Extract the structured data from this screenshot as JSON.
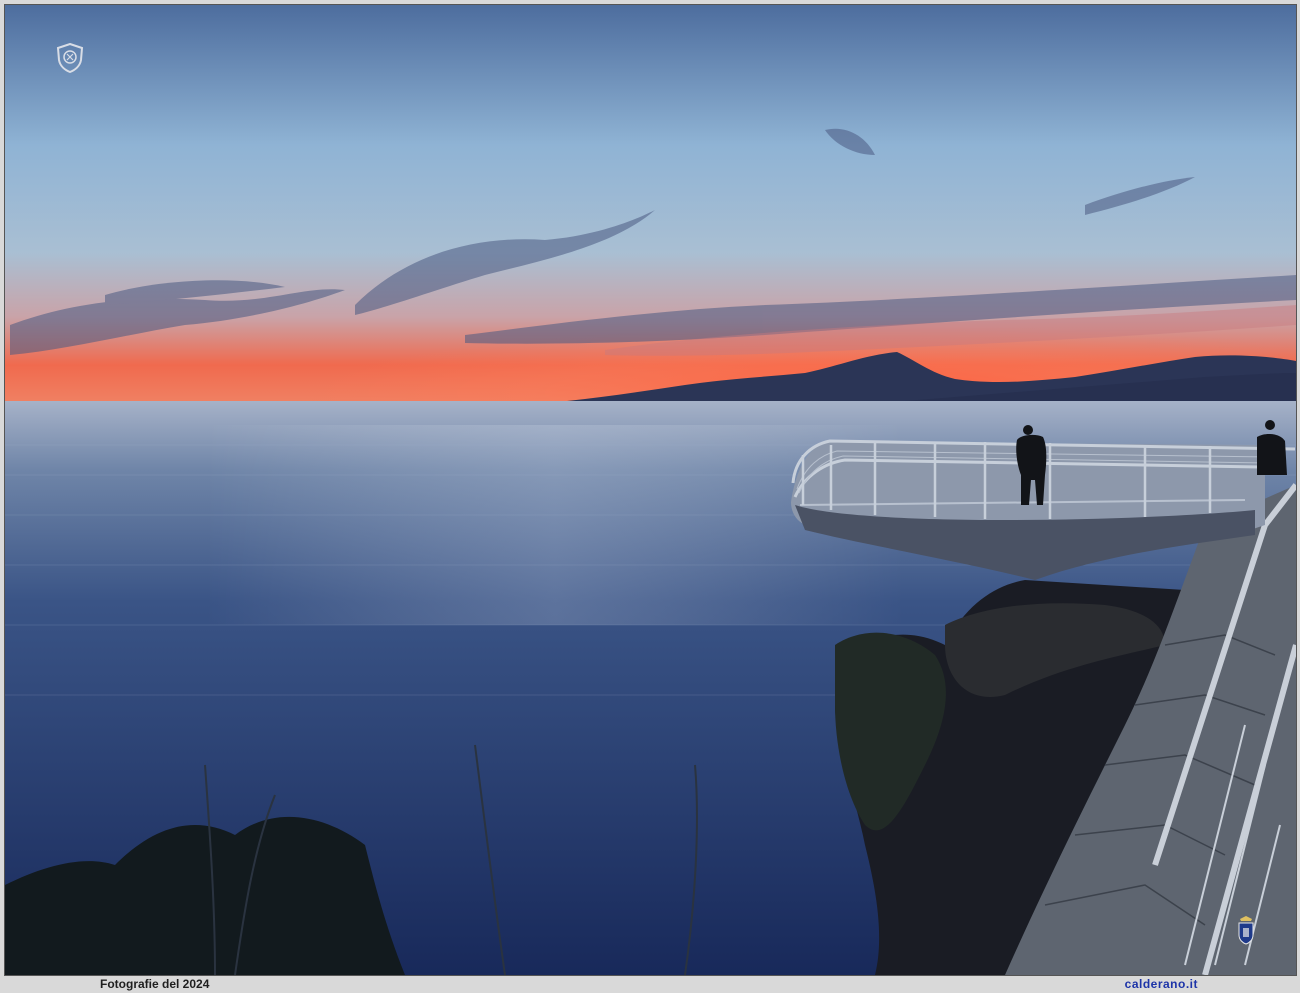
{
  "photo": {
    "subject": "sunset-over-sea-with-cliff-viewing-platform",
    "colors": {
      "sky_top": "#4a6a9a",
      "sky_mid": "#8eb1d2",
      "horizon_glow": "#ff5a3a",
      "sea": "#1f3566",
      "mountain": "#2b3556",
      "cliff": "#1a1c24"
    }
  },
  "footer": {
    "left_text": "Fotografie del 2024",
    "right_text": "calderano.it"
  },
  "icons": {
    "badge": "shield-logo-icon",
    "crest": "crest-icon"
  }
}
